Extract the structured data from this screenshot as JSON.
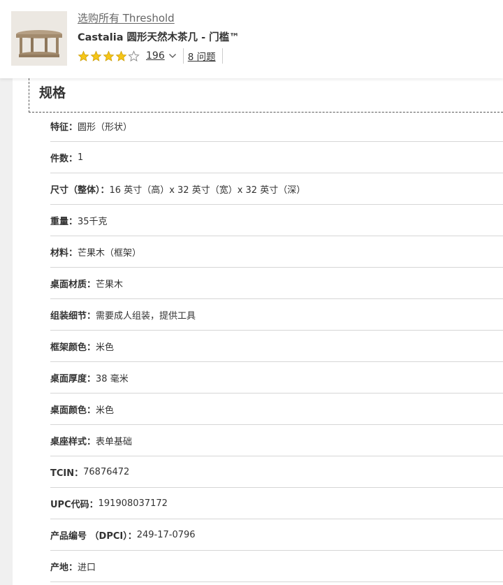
{
  "header": {
    "brand_link": "选购所有 Threshold",
    "product_title": "Castalia 圆形天然木茶几 - 门槛™",
    "rating": {
      "stars_filled": 4,
      "stars_total": 5,
      "review_count": "196"
    },
    "questions_link": "8 问题",
    "thumbnail_icon": "round-coffee-table-thumbnail",
    "star_color": "#f5c518"
  },
  "specs": {
    "heading": "规格",
    "rows": [
      {
        "label": "特征：",
        "value": "圆形（形状）"
      },
      {
        "label": "件数：",
        "value": "1"
      },
      {
        "label": "尺寸（整体）：",
        "value": "16 英寸（高）x 32 英寸（宽）x 32 英寸（深）"
      },
      {
        "label": "重量：",
        "value": "35千克"
      },
      {
        "label": "材料：",
        "value": "芒果木（框架）"
      },
      {
        "label": "桌面材质：",
        "value": "芒果木"
      },
      {
        "label": "组装细节：",
        "value": "需要成人组装，提供工具"
      },
      {
        "label": "框架颜色：",
        "value": "米色"
      },
      {
        "label": "桌面厚度：",
        "value": "38 毫米"
      },
      {
        "label": "桌面颜色：",
        "value": "米色"
      },
      {
        "label": "桌座样式：",
        "value": "表单基础"
      },
      {
        "label": "TCIN：",
        "value": "76876472"
      },
      {
        "label": "UPC代码：",
        "value": "191908037172"
      },
      {
        "label": "产品编号 （DPCI）：",
        "value": "249-17-0796"
      },
      {
        "label": "产地：",
        "value": "进口"
      }
    ]
  }
}
